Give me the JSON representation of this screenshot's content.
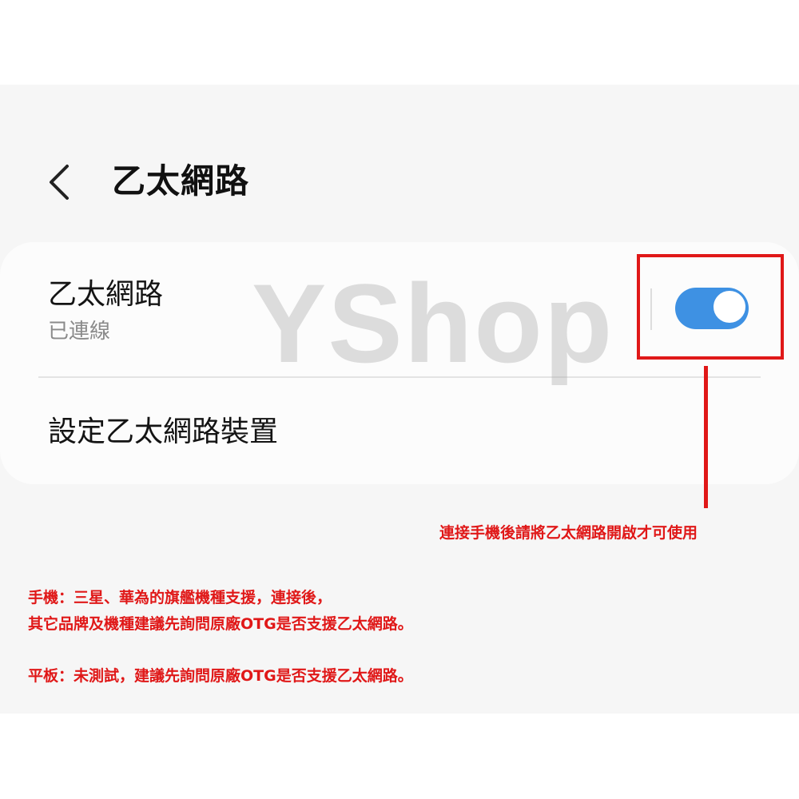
{
  "header": {
    "title": "乙太網路",
    "back_icon": "chevron-left-icon"
  },
  "ethernet_row": {
    "label": "乙太網路",
    "status": "已連線",
    "toggle_on": true,
    "toggle_color": "#3e91e3"
  },
  "setup_row": {
    "label": "設定乙太網路裝置"
  },
  "watermark": {
    "text": "YShop"
  },
  "annotations": {
    "toggle_note": "連接手機後請將乙太網路開啟才可使用",
    "phone_line1": "手機：三星、華為的旗艦機種支援，連接後，",
    "phone_line2": "其它品牌及機種建議先詢問原廠OTG是否支援乙太網路。",
    "tablet_line": "平板：未測試，建議先詢問原廠OTG是否支援乙太網路。",
    "color": "#e01818"
  }
}
